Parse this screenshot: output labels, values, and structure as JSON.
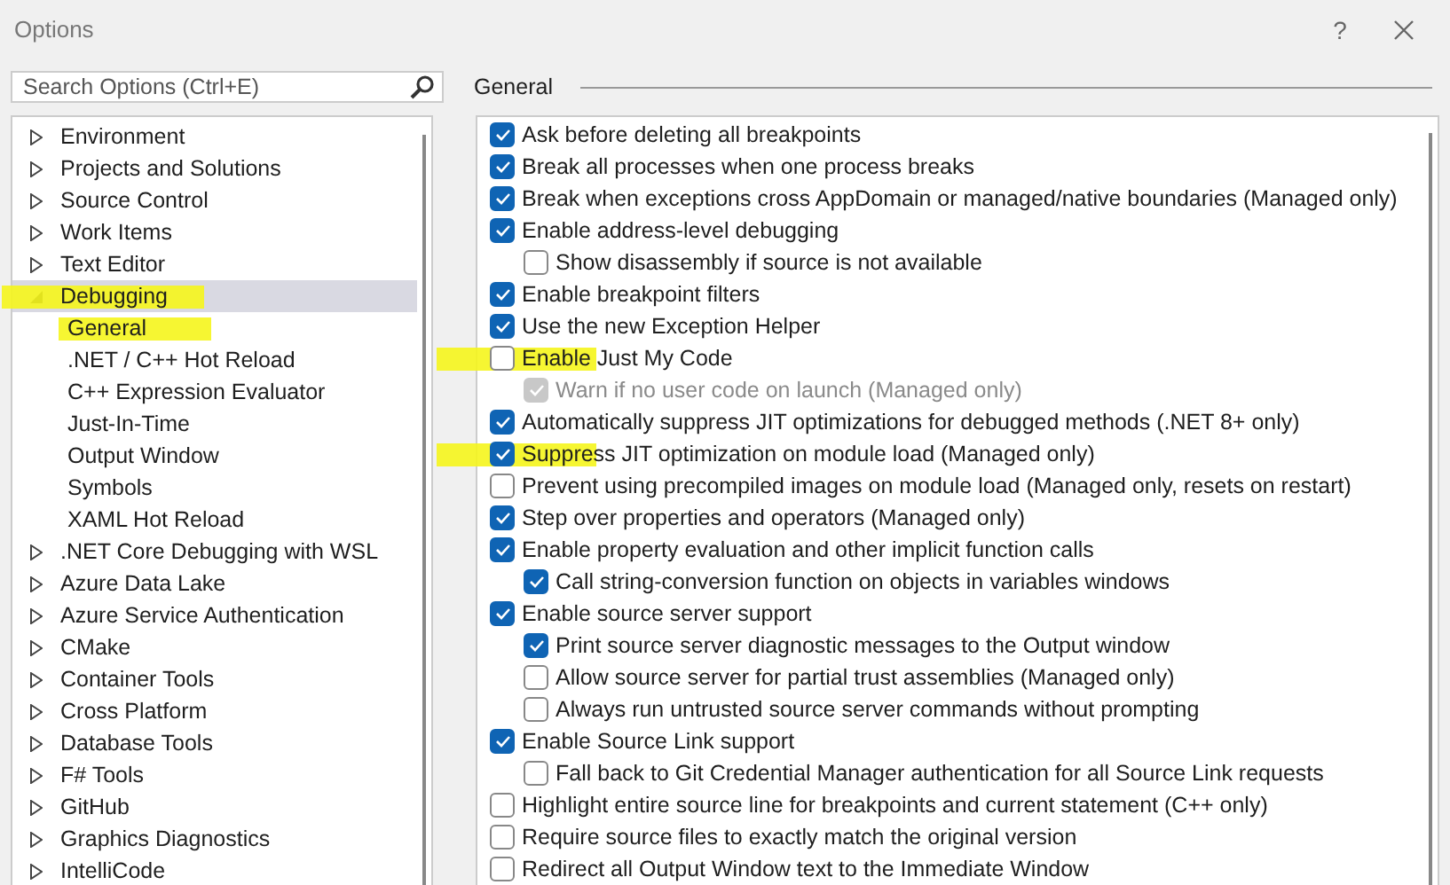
{
  "window": {
    "title": "Options",
    "help": "?"
  },
  "search": {
    "placeholder": "Search Options (Ctrl+E)"
  },
  "tree": [
    {
      "label": "Environment",
      "expanded": false,
      "selected": false,
      "highlighted": false
    },
    {
      "label": "Projects and Solutions",
      "expanded": false,
      "selected": false,
      "highlighted": false
    },
    {
      "label": "Source Control",
      "expanded": false,
      "selected": false,
      "highlighted": false
    },
    {
      "label": "Work Items",
      "expanded": false,
      "selected": false,
      "highlighted": false
    },
    {
      "label": "Text Editor",
      "expanded": false,
      "selected": false,
      "highlighted": false
    },
    {
      "label": "Debugging",
      "expanded": true,
      "selected": true,
      "highlighted": true,
      "children": [
        {
          "label": "General",
          "selected": false,
          "highlighted": true
        },
        {
          "label": ".NET / C++ Hot Reload",
          "selected": false,
          "highlighted": false
        },
        {
          "label": "C++ Expression Evaluator",
          "selected": false,
          "highlighted": false
        },
        {
          "label": "Just-In-Time",
          "selected": false,
          "highlighted": false
        },
        {
          "label": "Output Window",
          "selected": false,
          "highlighted": false
        },
        {
          "label": "Symbols",
          "selected": false,
          "highlighted": false
        },
        {
          "label": "XAML Hot Reload",
          "selected": false,
          "highlighted": false
        }
      ]
    },
    {
      "label": ".NET Core Debugging with WSL",
      "expanded": false,
      "selected": false,
      "highlighted": false
    },
    {
      "label": "Azure Data Lake",
      "expanded": false,
      "selected": false,
      "highlighted": false
    },
    {
      "label": "Azure Service Authentication",
      "expanded": false,
      "selected": false,
      "highlighted": false
    },
    {
      "label": "CMake",
      "expanded": false,
      "selected": false,
      "highlighted": false
    },
    {
      "label": "Container Tools",
      "expanded": false,
      "selected": false,
      "highlighted": false
    },
    {
      "label": "Cross Platform",
      "expanded": false,
      "selected": false,
      "highlighted": false
    },
    {
      "label": "Database Tools",
      "expanded": false,
      "selected": false,
      "highlighted": false
    },
    {
      "label": "F# Tools",
      "expanded": false,
      "selected": false,
      "highlighted": false
    },
    {
      "label": "GitHub",
      "expanded": false,
      "selected": false,
      "highlighted": false
    },
    {
      "label": "Graphics Diagnostics",
      "expanded": false,
      "selected": false,
      "highlighted": false
    },
    {
      "label": "IntelliCode",
      "expanded": false,
      "selected": false,
      "highlighted": false
    }
  ],
  "page": {
    "title": "General",
    "options": [
      {
        "label": "Ask before deleting all breakpoints",
        "checked": true
      },
      {
        "label": "Break all processes when one process breaks",
        "checked": true
      },
      {
        "label": "Break when exceptions cross AppDomain or managed/native boundaries (Managed only)",
        "checked": true
      },
      {
        "label": "Enable address-level debugging",
        "checked": true,
        "children": [
          {
            "label": "Show disassembly if source is not available",
            "checked": false
          }
        ]
      },
      {
        "label": "Enable breakpoint filters",
        "checked": true
      },
      {
        "label": "Use the new Exception Helper",
        "checked": true
      },
      {
        "label": "Enable Just My Code",
        "checked": false,
        "highlighted": true,
        "children": [
          {
            "label": "Warn if no user code on launch (Managed only)",
            "checked": true,
            "disabled": true
          }
        ]
      },
      {
        "label": "Automatically suppress JIT optimizations for debugged methods (.NET 8+ only)",
        "checked": true
      },
      {
        "label": "Suppress JIT optimization on module load (Managed only)",
        "checked": true,
        "highlighted": true
      },
      {
        "label": "Prevent using precompiled images on module load (Managed only, resets on restart)",
        "checked": false
      },
      {
        "label": "Step over properties and operators (Managed only)",
        "checked": true
      },
      {
        "label": "Enable property evaluation and other implicit function calls",
        "checked": true,
        "children": [
          {
            "label": "Call string-conversion function on objects in variables windows",
            "checked": true
          }
        ]
      },
      {
        "label": "Enable source server support",
        "checked": true,
        "children": [
          {
            "label": "Print source server diagnostic messages to the Output window",
            "checked": true
          },
          {
            "label": "Allow source server for partial trust assemblies (Managed only)",
            "checked": false
          },
          {
            "label": "Always run untrusted source server commands without prompting",
            "checked": false
          }
        ]
      },
      {
        "label": "Enable Source Link support",
        "checked": true,
        "children": [
          {
            "label": "Fall back to Git Credential Manager authentication for all Source Link requests",
            "checked": false
          }
        ]
      },
      {
        "label": "Highlight entire source line for breakpoints and current statement (C++ only)",
        "checked": false
      },
      {
        "label": "Require source files to exactly match the original version",
        "checked": false
      },
      {
        "label": "Redirect all Output Window text to the Immediate Window",
        "checked": false
      }
    ]
  }
}
